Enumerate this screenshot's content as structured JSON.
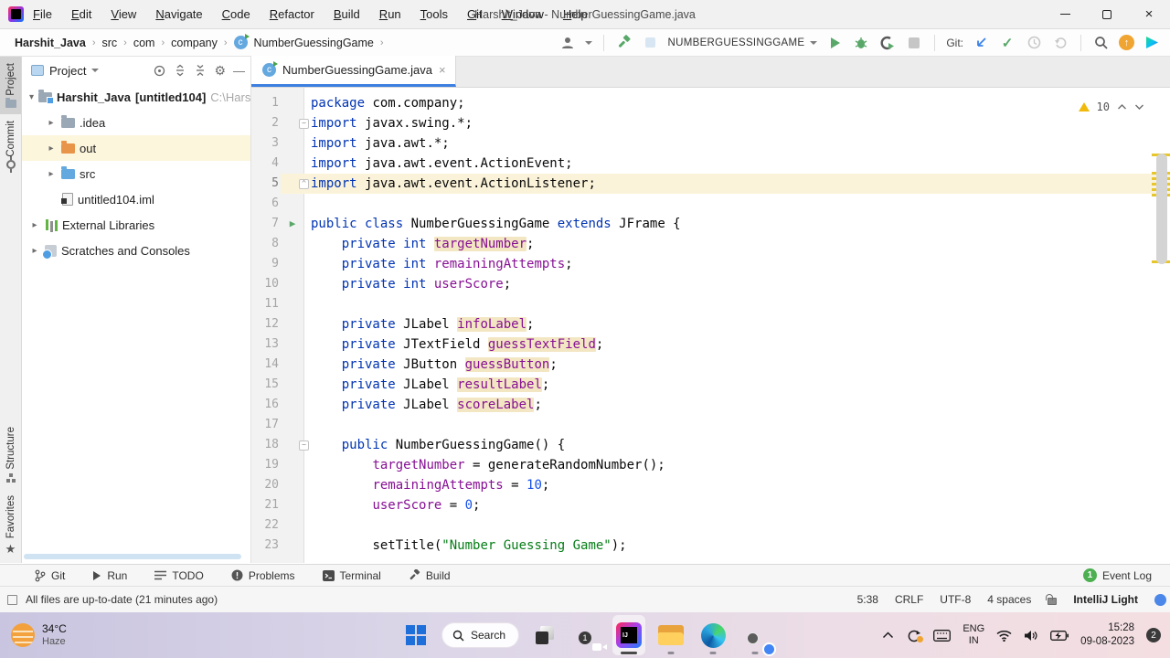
{
  "title_bar": {
    "menus": [
      "File",
      "Edit",
      "View",
      "Navigate",
      "Code",
      "Refactor",
      "Build",
      "Run",
      "Tools",
      "Git",
      "Window",
      "Help"
    ],
    "title": "Harshit_Java - NumberGuessingGame.java"
  },
  "toolbar": {
    "breadcrumbs": [
      "Harshit_Java",
      "src",
      "com",
      "company",
      "NumberGuessingGame"
    ],
    "run_config": "NUMBERGUESSINGGAME",
    "git_label": "Git:",
    "commit_check": "✓",
    "update_badge_arrow": "↑"
  },
  "tool_strip": {
    "project": "Project",
    "commit": "Commit",
    "structure": "Structure",
    "favorites": "Favorites",
    "star": "★"
  },
  "project_panel": {
    "header": "Project",
    "gear": "⚙",
    "minimize": "—",
    "tree": [
      {
        "chev": "▾",
        "name": "Harshit_Java",
        "module": "[untitled104]",
        "path": "C:\\Harshit_Ja"
      },
      {
        "chev": "▸",
        "name": ".idea"
      },
      {
        "chev": "▸",
        "name": "out"
      },
      {
        "chev": "▸",
        "name": "src"
      },
      {
        "chev": "",
        "name": "untitled104.iml"
      },
      {
        "chev": "▸",
        "name": "External Libraries"
      },
      {
        "chev": "▸",
        "name": "Scratches and Consoles"
      }
    ]
  },
  "editor": {
    "tab": "NumberGuessingGame.java",
    "tab_class_letter": "c",
    "close": "×",
    "warnings": "10",
    "warning_stripe_offsets": [
      106,
      126,
      132,
      138,
      144,
      150,
      223
    ],
    "lines": [
      {
        "num": "1",
        "segs": [
          [
            "package ",
            "kw"
          ],
          [
            "com.company;",
            "txt"
          ]
        ]
      },
      {
        "num": "2",
        "marker": "fold",
        "segs": [
          [
            "import ",
            "kw"
          ],
          [
            "javax.swing.*;",
            "txt"
          ]
        ]
      },
      {
        "num": "3",
        "segs": [
          [
            "import ",
            "kw"
          ],
          [
            "java.awt.*;",
            "txt"
          ]
        ]
      },
      {
        "num": "4",
        "segs": [
          [
            "import ",
            "kw"
          ],
          [
            "java.awt.event.ActionEvent;",
            "txt"
          ]
        ]
      },
      {
        "num": "5",
        "caret": true,
        "marker": "foldend",
        "segs": [
          [
            "import ",
            "kw"
          ],
          [
            "java.awt.event.ActionListener;",
            "txt"
          ]
        ]
      },
      {
        "num": "6",
        "segs": []
      },
      {
        "num": "7",
        "marker": "run",
        "segs": [
          [
            "public class ",
            "kw"
          ],
          [
            "NumberGuessingGame ",
            "txt"
          ],
          [
            "extends ",
            "kw"
          ],
          [
            "JFrame {",
            "txt"
          ]
        ]
      },
      {
        "num": "8",
        "segs": [
          [
            "    ",
            "txt"
          ],
          [
            "private int ",
            "kw"
          ],
          [
            "targetNumber",
            "fld hl"
          ],
          [
            ";",
            "txt"
          ]
        ]
      },
      {
        "num": "9",
        "segs": [
          [
            "    ",
            "txt"
          ],
          [
            "private int ",
            "kw"
          ],
          [
            "remainingAttempts",
            "fld"
          ],
          [
            ";",
            "txt"
          ]
        ]
      },
      {
        "num": "10",
        "segs": [
          [
            "    ",
            "txt"
          ],
          [
            "private int ",
            "kw"
          ],
          [
            "userScore",
            "fld"
          ],
          [
            ";",
            "txt"
          ]
        ]
      },
      {
        "num": "11",
        "segs": []
      },
      {
        "num": "12",
        "segs": [
          [
            "    ",
            "txt"
          ],
          [
            "private ",
            "kw"
          ],
          [
            "JLabel ",
            "txt"
          ],
          [
            "infoLabel",
            "fld hl"
          ],
          [
            ";",
            "txt"
          ]
        ]
      },
      {
        "num": "13",
        "segs": [
          [
            "    ",
            "txt"
          ],
          [
            "private ",
            "kw"
          ],
          [
            "JTextField ",
            "txt"
          ],
          [
            "guessTextField",
            "fld hl"
          ],
          [
            ";",
            "txt"
          ]
        ]
      },
      {
        "num": "14",
        "segs": [
          [
            "    ",
            "txt"
          ],
          [
            "private ",
            "kw"
          ],
          [
            "JButton ",
            "txt"
          ],
          [
            "guessButton",
            "fld hl"
          ],
          [
            ";",
            "txt"
          ]
        ]
      },
      {
        "num": "15",
        "segs": [
          [
            "    ",
            "txt"
          ],
          [
            "private ",
            "kw"
          ],
          [
            "JLabel ",
            "txt"
          ],
          [
            "resultLabel",
            "fld hl"
          ],
          [
            ";",
            "txt"
          ]
        ]
      },
      {
        "num": "16",
        "segs": [
          [
            "    ",
            "txt"
          ],
          [
            "private ",
            "kw"
          ],
          [
            "JLabel ",
            "txt"
          ],
          [
            "scoreLabel",
            "fld hl"
          ],
          [
            ";",
            "txt"
          ]
        ]
      },
      {
        "num": "17",
        "segs": []
      },
      {
        "num": "18",
        "marker": "fold",
        "segs": [
          [
            "    ",
            "txt"
          ],
          [
            "public ",
            "kw"
          ],
          [
            "NumberGuessingGame() {",
            "txt"
          ]
        ]
      },
      {
        "num": "19",
        "segs": [
          [
            "        ",
            "txt"
          ],
          [
            "targetNumber",
            "fld"
          ],
          [
            " = generateRandomNumber();",
            "txt"
          ]
        ]
      },
      {
        "num": "20",
        "segs": [
          [
            "        ",
            "txt"
          ],
          [
            "remainingAttempts",
            "fld"
          ],
          [
            " = ",
            "txt"
          ],
          [
            "10",
            "num"
          ],
          [
            ";",
            "txt"
          ]
        ]
      },
      {
        "num": "21",
        "segs": [
          [
            "        ",
            "txt"
          ],
          [
            "userScore",
            "fld"
          ],
          [
            " = ",
            "txt"
          ],
          [
            "0",
            "num"
          ],
          [
            ";",
            "txt"
          ]
        ]
      },
      {
        "num": "22",
        "segs": []
      },
      {
        "num": "23",
        "segs": [
          [
            "        ",
            "txt"
          ],
          [
            "setTitle(",
            "txt"
          ],
          [
            "\"Number Guessing Game\"",
            "str"
          ],
          [
            ");",
            "txt"
          ]
        ]
      }
    ]
  },
  "tool_window_bar": {
    "git": "Git",
    "run": "Run",
    "todo": "TODO",
    "problems": "Problems",
    "terminal": "Terminal",
    "build": "Build",
    "event_log": "Event Log",
    "event_count": "1"
  },
  "status_bar": {
    "left": "All files are up-to-date (21 minutes ago)",
    "position": "5:38",
    "line_separator": "CRLF",
    "encoding": "UTF-8",
    "indent": "4 spaces",
    "theme": "IntelliJ Light"
  },
  "taskbar": {
    "weather_temp": "34°C",
    "weather_desc": "Haze",
    "search_label": "Search",
    "chat_badge": "1",
    "chrome_badge": "",
    "lang_line1": "ENG",
    "lang_line2": "IN",
    "time": "15:28",
    "date": "09-08-2023",
    "notification_count": "2"
  },
  "icons": {
    "breadcrumb_sep": "›",
    "tree_caret_line": ""
  },
  "colors": {
    "accent_blue": "#3d7fe0",
    "keyword": "#0033b3",
    "field": "#871094",
    "string": "#067d17",
    "number": "#1750eb",
    "warn_stripe": "#e7c62d",
    "caret_line": "#fbf3d9",
    "unused_highlight": "#f2e6c3",
    "run_green": "#59a869",
    "folder_orange": "#e8954a",
    "folder_blue": "#64a8e0"
  }
}
